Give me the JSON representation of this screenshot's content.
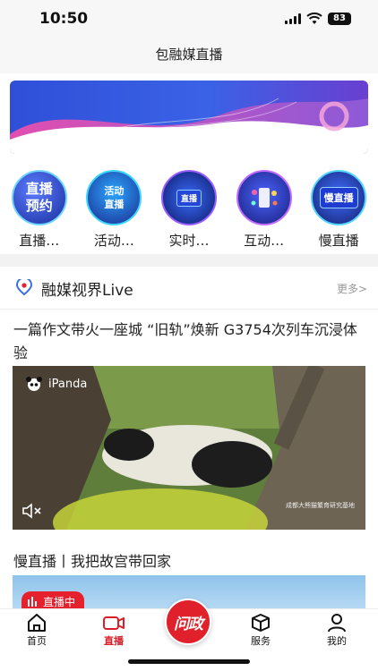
{
  "status_bar": {
    "time": "10:50",
    "battery": "83"
  },
  "nav": {
    "title": "包融媒直播"
  },
  "entries": [
    {
      "badge_line1": "直播",
      "badge_line2": "预约",
      "label": "直播…",
      "icon": "live-reservation-icon"
    },
    {
      "badge_line1": "活动",
      "badge_line2": "直播",
      "label": "活动…",
      "icon": "event-live-icon"
    },
    {
      "badge_line1": "直播",
      "badge_line2": "",
      "label": "实时…",
      "icon": "realtime-live-icon"
    },
    {
      "badge_line1": "",
      "badge_line2": "",
      "label": "互动…",
      "icon": "interactive-live-icon"
    },
    {
      "badge_line1": "慢直播",
      "badge_line2": "",
      "label": "慢直播",
      "icon": "slow-live-icon"
    }
  ],
  "section": {
    "title": "融媒视界Live",
    "more": "更多>"
  },
  "article1": {
    "title": "一篇作文带火一座城 “旧轨”焕新 G3754次列车沉浸体验"
  },
  "video": {
    "brand": "iPanda",
    "watermark": "成都大熊猫繁育研究基地"
  },
  "article2": {
    "title": "慢直播丨我把故宫带回家",
    "badge": "直播中"
  },
  "tabs": [
    {
      "label": "首页",
      "icon": "home-icon"
    },
    {
      "label": "直播",
      "icon": "video-camera-icon"
    },
    {
      "label": "问政",
      "icon": "inquiry-icon"
    },
    {
      "label": "服务",
      "icon": "box-icon"
    },
    {
      "label": "我的",
      "icon": "user-icon"
    }
  ],
  "colors": {
    "accent": "#d81e28",
    "banner_blue": "#3a5fe0",
    "banner_pink": "#d64fb8"
  }
}
